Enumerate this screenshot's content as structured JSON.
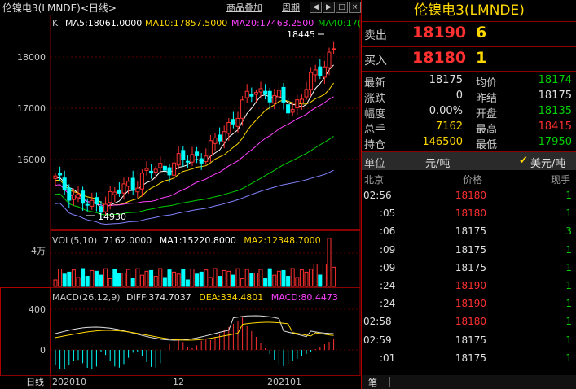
{
  "window": {
    "title": "伦镍电3(LMNDE)<日线>",
    "toolbar": {
      "overlay": "商品叠加",
      "period": "周期"
    },
    "nav_icons": [
      "arrow-left-icon",
      "arrow-right-icon",
      "expand-icon",
      "close-icon"
    ]
  },
  "kline": {
    "label": "K",
    "ma": [
      {
        "label": "MA5:18061.0000",
        "color": "#ffffff"
      },
      {
        "label": "MA10:17857.5000",
        "color": "#ffd800"
      },
      {
        "label": "MA20:17463.2500",
        "color": "#ff40ff"
      },
      {
        "label": "MA40:17(",
        "color": "#00d000"
      }
    ],
    "y_ticks": [
      "18000",
      "17000",
      "16000"
    ],
    "high_label": "18445",
    "low_label": "14930",
    "up_color": "#ff3030",
    "down_color": "#00ffff"
  },
  "volume": {
    "label": "VOL(5,10)",
    "value": "7162.0000",
    "ma1": "MA1:15220.8000",
    "ma2": "MA2:12348.7000",
    "y_tick": "4万"
  },
  "macd": {
    "label": "MACD(26,12,9)",
    "diff": "DIFF:374.7037",
    "dea": "DEA:334.4801",
    "macd": "MACD:80.4473",
    "y_ticks": [
      "400",
      "0"
    ]
  },
  "bottom": {
    "period_label": "日线",
    "x_ticks": [
      "202010",
      "12",
      "202101"
    ]
  },
  "quote": {
    "title": "伦镍电3(LMNDE)",
    "sell": {
      "label": "卖出",
      "price": "18190",
      "qty": "6"
    },
    "buy": {
      "label": "买入",
      "price": "18180",
      "qty": "1"
    },
    "stats": [
      {
        "l1": "最新",
        "v1": "18175",
        "c1": "#e0e0e0",
        "l2": "均价",
        "v2": "18174",
        "c2": "#00d000"
      },
      {
        "l1": "涨跌",
        "v1": "0",
        "c1": "#e0e0e0",
        "l2": "昨结",
        "v2": "18175",
        "c2": "#e0e0e0"
      },
      {
        "l1": "幅度",
        "v1": "0.00%",
        "c1": "#e0e0e0",
        "l2": "开盘",
        "v2": "18135",
        "c2": "#00d000"
      },
      {
        "l1": "总手",
        "v1": "7162",
        "c1": "#ffd800",
        "l2": "最高",
        "v2": "18415",
        "c2": "#ff3030"
      },
      {
        "l1": "持仓",
        "v1": "146500",
        "c1": "#ffd800",
        "l2": "最低",
        "v2": "17950",
        "c2": "#00d000"
      }
    ],
    "unit": {
      "label": "单位",
      "cny": "元/吨",
      "usd": "美元/吨"
    },
    "ticks_header": {
      "place": "北京",
      "price": "价格",
      "vol": "现手"
    },
    "ticks": [
      {
        "time": "02:56",
        "price": "18180",
        "color": "#ff3030",
        "vol": "1"
      },
      {
        "time": ":05",
        "price": "18180",
        "color": "#ff3030",
        "vol": "1"
      },
      {
        "time": ":06",
        "price": "18175",
        "color": "#e0e0e0",
        "vol": "3"
      },
      {
        "time": ":09",
        "price": "18175",
        "color": "#e0e0e0",
        "vol": "1"
      },
      {
        "time": ":09",
        "price": "18175",
        "color": "#e0e0e0",
        "vol": "1"
      },
      {
        "time": ":24",
        "price": "18190",
        "color": "#ff3030",
        "vol": "1"
      },
      {
        "time": ":24",
        "price": "18190",
        "color": "#ff3030",
        "vol": "1"
      },
      {
        "time": "02:58",
        "price": "18180",
        "color": "#ff3030",
        "vol": "1"
      },
      {
        "time": "02:59",
        "price": "18175",
        "color": "#e0e0e0",
        "vol": "1"
      },
      {
        "time": ":01",
        "price": "18175",
        "color": "#e0e0e0",
        "vol": "1"
      }
    ],
    "footer_tab": "笔"
  }
}
